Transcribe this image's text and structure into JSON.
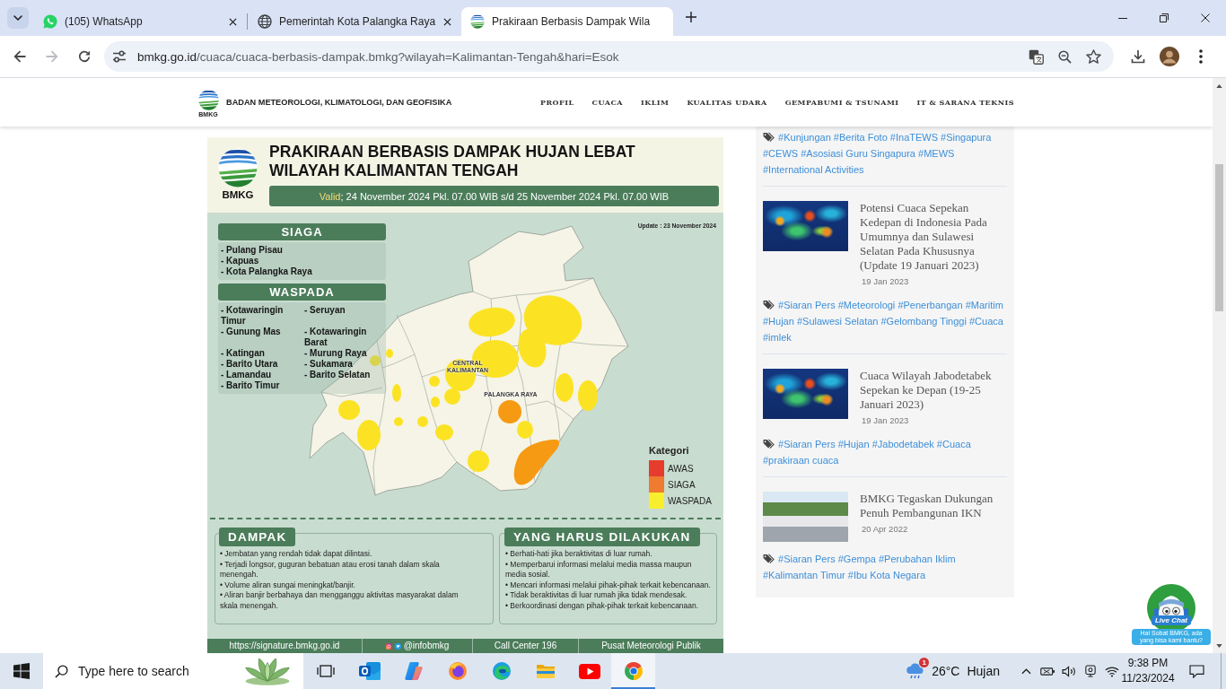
{
  "browser": {
    "tabs": [
      {
        "kind": "chat",
        "title": "(105) WhatsApp",
        "selected": false
      },
      {
        "kind": "globe",
        "title": "Pemerintah Kota Palangka Raya",
        "selected": false
      },
      {
        "kind": "emblem",
        "title": "Prakiraan Berbasis Dampak Wila",
        "selected": true
      }
    ],
    "nav_buttons": [
      {
        "kind": "back",
        "disabled": false
      },
      {
        "kind": "forward",
        "disabled": true
      },
      {
        "kind": "reload",
        "disabled": false
      }
    ],
    "address_bar": {
      "host": "bmkg.go.id",
      "path": "/cuaca/cuaca-berbasis-dampak.bmkg?wilayah=Kalimantan-Tengah&hari=Esok"
    }
  },
  "site_header": {
    "logo_text": "BMKG",
    "org_name": "BADAN METEOROLOGI, KLIMATOLOGI, DAN GEOFISIKA",
    "nav": [
      "PROFIL",
      "CUACA",
      "IKLIM",
      "KUALITAS UDARA",
      "GEMPABUMI & TSUNAMI",
      "IT & SARANA TEKNIS"
    ]
  },
  "infographic": {
    "logo_text": "BMKG",
    "title": "PRAKIRAAN BERBASIS DAMPAK HUJAN LEBAT WILAYAH KALIMANTAN TENGAH",
    "validity": {
      "label": "Valid",
      "text": "; 24 November 2024 Pkl. 07.00 WIB s/d 25 November 2024 Pkl. 07.00 WIB"
    },
    "update": "Update : 23 November 2024",
    "siaga": {
      "heading": "SIAGA",
      "areas": [
        "- Pulang Pisau",
        "- Kapuas",
        "- Kota Palangka Raya"
      ]
    },
    "waspada": {
      "heading": "WASPADA",
      "areas": [
        "- Kotawaringin Timur",
        "- Seruyan",
        "- Gunung Mas",
        "- Kotawaringin Barat",
        "- Katingan",
        "- Murung Raya",
        "- Barito Utara",
        "- Sukamara",
        "- Lamandau",
        "- Barito Selatan",
        "- Barito Timur"
      ]
    },
    "map": {
      "labels": [
        "CENTRAL KALIMANTAN",
        "PALANGKA RAYA"
      ],
      "zones": [
        {
          "kind": "waspada"
        },
        {
          "kind": "waspada"
        },
        {
          "kind": "waspada"
        },
        {
          "kind": "waspada"
        },
        {
          "kind": "waspada"
        },
        {
          "kind": "waspada"
        },
        {
          "kind": "waspada"
        },
        {
          "kind": "waspada"
        },
        {
          "kind": "waspada"
        },
        {
          "kind": "waspada"
        },
        {
          "kind": "waspada"
        },
        {
          "kind": "waspada"
        },
        {
          "kind": "waspada"
        },
        {
          "kind": "waspada"
        },
        {
          "kind": "waspada"
        },
        {
          "kind": "waspada"
        },
        {
          "kind": "waspada"
        },
        {
          "kind": "waspada"
        },
        {
          "kind": "waspada"
        },
        {
          "kind": "waspada"
        },
        {
          "kind": "siaga"
        },
        {
          "kind": "siaga"
        }
      ]
    },
    "legend": {
      "title": "Kategori",
      "items": [
        {
          "label": "AWAS",
          "color": "#e63c2e"
        },
        {
          "label": "SIAGA",
          "color": "#ee7b30"
        },
        {
          "label": "WASPADA",
          "color": "#f7ef2d"
        }
      ]
    },
    "impact": {
      "heading": "DAMPAK",
      "points": [
        "• Jembatan yang rendah tidak dapat dilintasi.",
        "• Terjadi longsor, guguran bebatuan atau erosi tanah dalam skala menengah.",
        "• Volume aliran sungai meningkat/banjir.",
        "• Aliran banjir berbahaya dan mengganggu aktivitas masyarakat dalam skala menengah."
      ]
    },
    "actions": {
      "heading": "YANG HARUS DILAKUKAN",
      "points": [
        "• Berhati-hati jika beraktivitas di luar rumah.",
        "• Memperbarui informasi melalui media massa maupun media sosial.",
        "• Mencari informasi melalui pihak-pihak terkait kebencanaan.",
        "• Tidak beraktivitas di luar rumah jika tidak mendesak.",
        "• Berkoordinasi dengan pihak-pihak terkait kebencanaan."
      ]
    },
    "footer": [
      {
        "kind": "link",
        "text": "https://signature.bmkg.go.id"
      },
      {
        "kind": "social",
        "text": "@infobmkg"
      },
      {
        "kind": "text",
        "text": "Call Center 196"
      },
      {
        "kind": "text",
        "text": "Pusat Meteorologi Publik"
      }
    ]
  },
  "sidebar": {
    "items": [
      {
        "kind": "tags",
        "tags": [
          "#Kunjungan",
          "#Berita Foto",
          "#InaTEWS",
          "#Singapura",
          "#CEWS",
          "#Asosiasi Guru Singapura",
          "#MEWS",
          "#International Activities"
        ]
      },
      {
        "kind": "article",
        "title": "Potensi Cuaca Sepekan Kedepan di Indonesia Pada Umumnya dan Sulawesi Selatan Pada Khususnya (Update 19 Januari 2023)",
        "date": "19 Jan 2023"
      },
      {
        "kind": "tags",
        "tags": [
          "#Siaran Pers",
          "#Meteorologi",
          "#Penerbangan",
          "#Maritim",
          "#Hujan",
          "#Sulawesi Selatan",
          "#Gelombang Tinggi",
          "#Cuaca",
          "#imlek"
        ]
      },
      {
        "kind": "article",
        "title": "Cuaca Wilayah Jabodetabek Sepekan ke Depan (19-25 Januari 2023)",
        "date": "19 Jan 2023"
      },
      {
        "kind": "tags",
        "tags": [
          "#Siaran Pers",
          "#Hujan",
          "#Jabodetabek",
          "#Cuaca",
          "#prakiraan cuaca"
        ]
      },
      {
        "kind": "article",
        "title": "BMKG Tegaskan Dukungan Penuh Pembangunan IKN",
        "date": "20 Apr 2022"
      },
      {
        "kind": "tags",
        "tags": [
          "#Siaran Pers",
          "#Gempa",
          "#Perubahan Iklim",
          "#Kalimantan Timur",
          "#Ibu Kota Negara"
        ]
      }
    ]
  },
  "live_chat": {
    "label": "Live Chat",
    "greeting": "Hai Sobat BMKG, ada yang bisa kami bantu?"
  },
  "taskbar": {
    "search_placeholder": "Type here to search",
    "apps": [
      {
        "kind": "task-view",
        "active": false
      },
      {
        "kind": "mail",
        "active": false
      },
      {
        "kind": "copilot",
        "active": false
      },
      {
        "kind": "firefox",
        "active": false
      },
      {
        "kind": "edge",
        "active": false
      },
      {
        "kind": "files",
        "active": false
      },
      {
        "kind": "youtube",
        "active": false
      },
      {
        "kind": "chrome",
        "active": true
      }
    ],
    "weather": {
      "badge": "1",
      "temperature": "26°C",
      "condition": "Hujan"
    },
    "clock": {
      "time": "9:38 PM",
      "date": "11/23/2024"
    }
  }
}
